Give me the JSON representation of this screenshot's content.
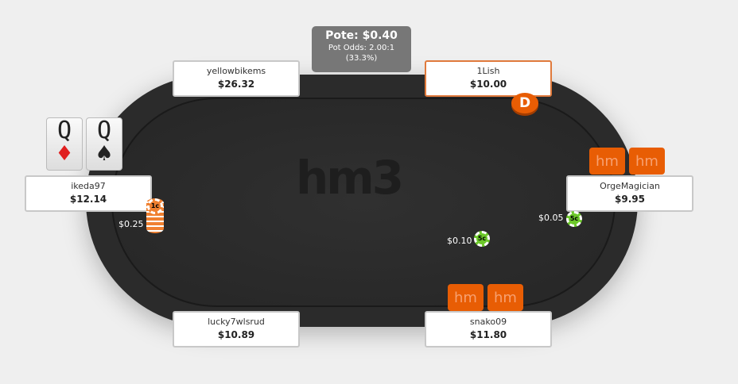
{
  "pot": {
    "title": "Pote: $0.40",
    "odds": "Pot Odds: 2.00:1",
    "percent": "(33.3%)"
  },
  "logo": "hm3",
  "dealer": "D",
  "seats": [
    {
      "name": "yellowbikems",
      "stack": "$26.32"
    },
    {
      "name": "1Lish",
      "stack": "$10.00"
    },
    {
      "name": "ikeda97",
      "stack": "$12.14"
    },
    {
      "name": "OrgeMagician",
      "stack": "$9.95"
    },
    {
      "name": "lucky7wlsrud",
      "stack": "$10.89"
    },
    {
      "name": "snako09",
      "stack": "$11.80"
    }
  ],
  "hero_cards": [
    {
      "rank": "Q",
      "suit": "♦",
      "color": "#e02020"
    },
    {
      "rank": "Q",
      "suit": "♠",
      "color": "#222222"
    }
  ],
  "hm_label": "hm",
  "bets": [
    {
      "amount": "$0.25",
      "chip": "1c"
    },
    {
      "amount": "$0.10",
      "chip": "5c"
    },
    {
      "amount": "$0.05",
      "chip": "5c"
    }
  ],
  "colors": {
    "accent": "#e85d04",
    "table": "#2b2b2b"
  }
}
